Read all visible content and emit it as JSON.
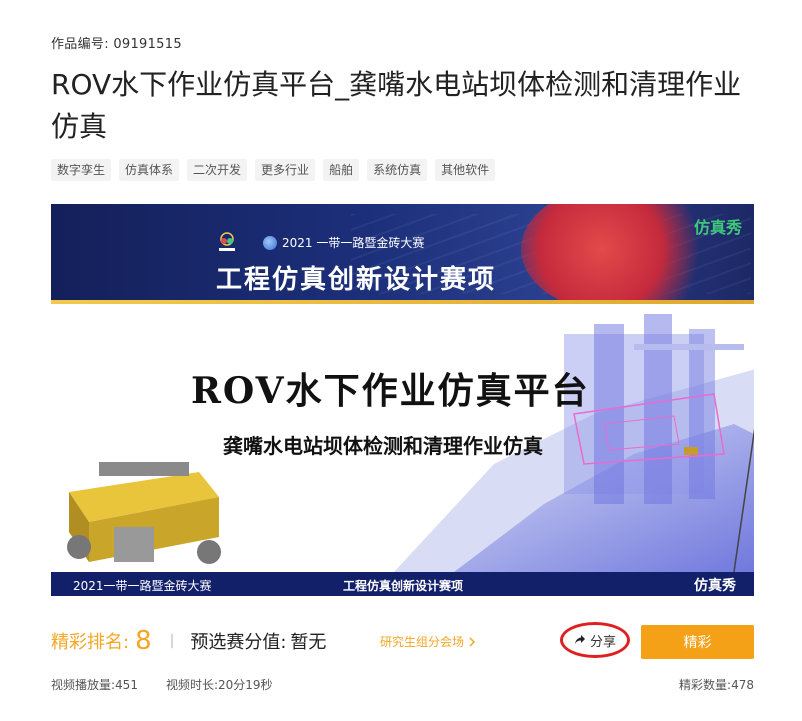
{
  "work_number": {
    "label": "作品编号:",
    "value": "09191515"
  },
  "title": "ROV水下作业仿真平台_龚嘴水电站坝体检测和清理作业仿真",
  "tags": [
    "数字孪生",
    "仿真体系",
    "二次开发",
    "更多行业",
    "船舶",
    "系统仿真",
    "其他软件"
  ],
  "banner": {
    "contest_year": "2021 一带一路暨金砖大赛",
    "brand": "仿真秀",
    "track_title": "工程仿真创新设计赛项",
    "main_title": "ROV水下作业仿真平台",
    "subtitle": "龚嘴水电站坝体检测和清理作业仿真",
    "footer_left": "2021一带一路暨金砖大赛",
    "footer_center": "工程仿真创新设计赛项",
    "footer_right": "仿真秀"
  },
  "rank": {
    "label": "精彩排名:",
    "value": "8"
  },
  "divider": "|",
  "prelim": {
    "label": "预选赛分值:",
    "value": "暂无"
  },
  "venue_link": "研究生组分会场",
  "share_label": "分享",
  "excellent_label": "精彩",
  "stats": {
    "plays_label": "视频播放量:",
    "plays": "451",
    "duration_label": "视频时长:",
    "duration": "20分19秒",
    "excellent_count_label": "精彩数量:",
    "excellent_count": "478"
  },
  "colors": {
    "accent": "#f5a623",
    "button": "#f5a117",
    "share_circle": "#e02020",
    "banner_navy": "#14205a"
  },
  "icons": [
    "brics-logo-icon",
    "globe-icon",
    "chevron-right-icon",
    "share-arrow-icon"
  ]
}
